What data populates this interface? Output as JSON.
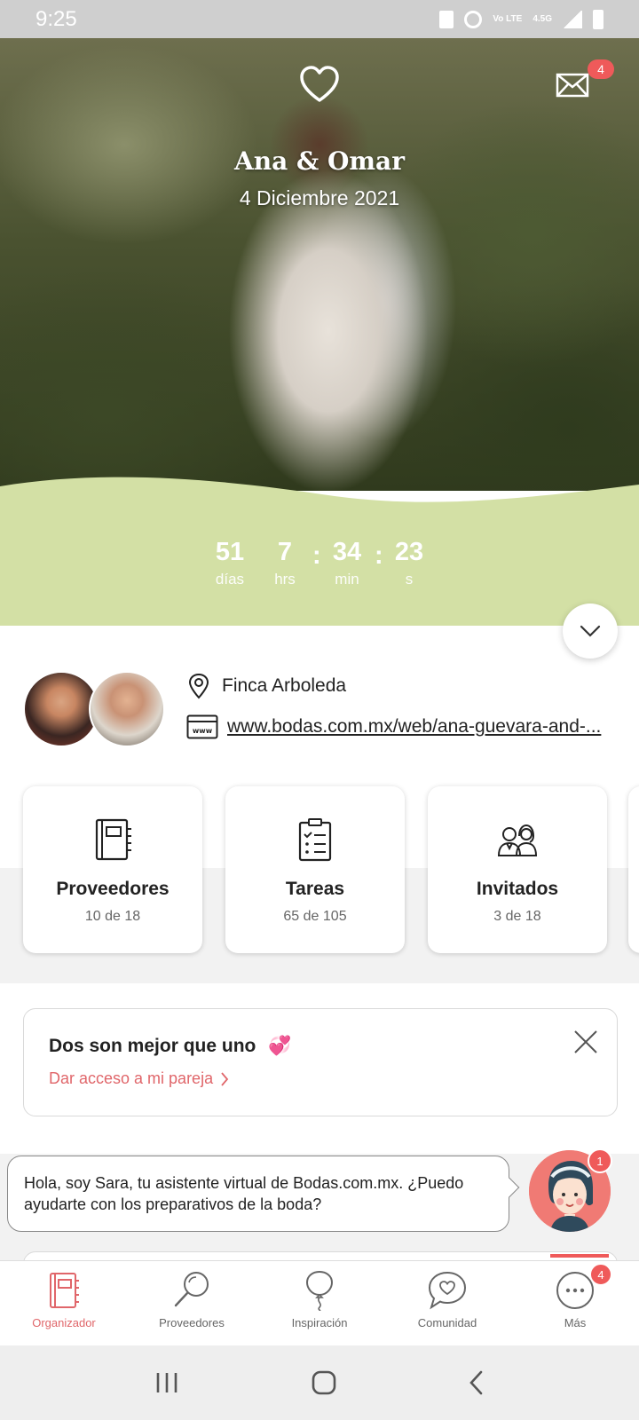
{
  "status_bar": {
    "time": "9:25",
    "network_text": "Vo LTE",
    "network_gen": "4.5G"
  },
  "hero": {
    "couple_name": "Ana & Omar",
    "wedding_date": "4 Diciembre 2021",
    "mail_badge": "4"
  },
  "countdown": {
    "days": "51",
    "days_label": "días",
    "hours": "7",
    "hours_label": "hrs",
    "minutes": "34",
    "minutes_label": "min",
    "seconds": "23",
    "seconds_label": "s",
    "separator": ":"
  },
  "info": {
    "venue": "Finca Arboleda",
    "website": "www.bodas.com.mx/web/ana-guevara-and-..."
  },
  "cards": [
    {
      "title": "Proveedores",
      "subtitle": "10 de 18",
      "icon": "notebook-icon"
    },
    {
      "title": "Tareas",
      "subtitle": "65 de 105",
      "icon": "checklist-icon"
    },
    {
      "title": "Invitados",
      "subtitle": "3 de 18",
      "icon": "guests-icon"
    }
  ],
  "promo": {
    "title": "Dos son mejor que uno",
    "emoji": "💞",
    "link": "Dar acceso a mi pareja"
  },
  "assistant": {
    "message": "Hola, soy Sara, tu asistente virtual de Bodas.com.mx. ¿Puedo ayudarte con los preparativos de la boda?",
    "badge": "1"
  },
  "bottom_nav": {
    "items": [
      {
        "label": "Organizador",
        "active": true
      },
      {
        "label": "Proveedores"
      },
      {
        "label": "Inspiración"
      },
      {
        "label": "Comunidad"
      },
      {
        "label": "Más",
        "badge": "4"
      }
    ]
  },
  "colors": {
    "accent": "#e0666a",
    "countdown_bg": "#d3e0a5",
    "badge": "#ef5a5a"
  }
}
